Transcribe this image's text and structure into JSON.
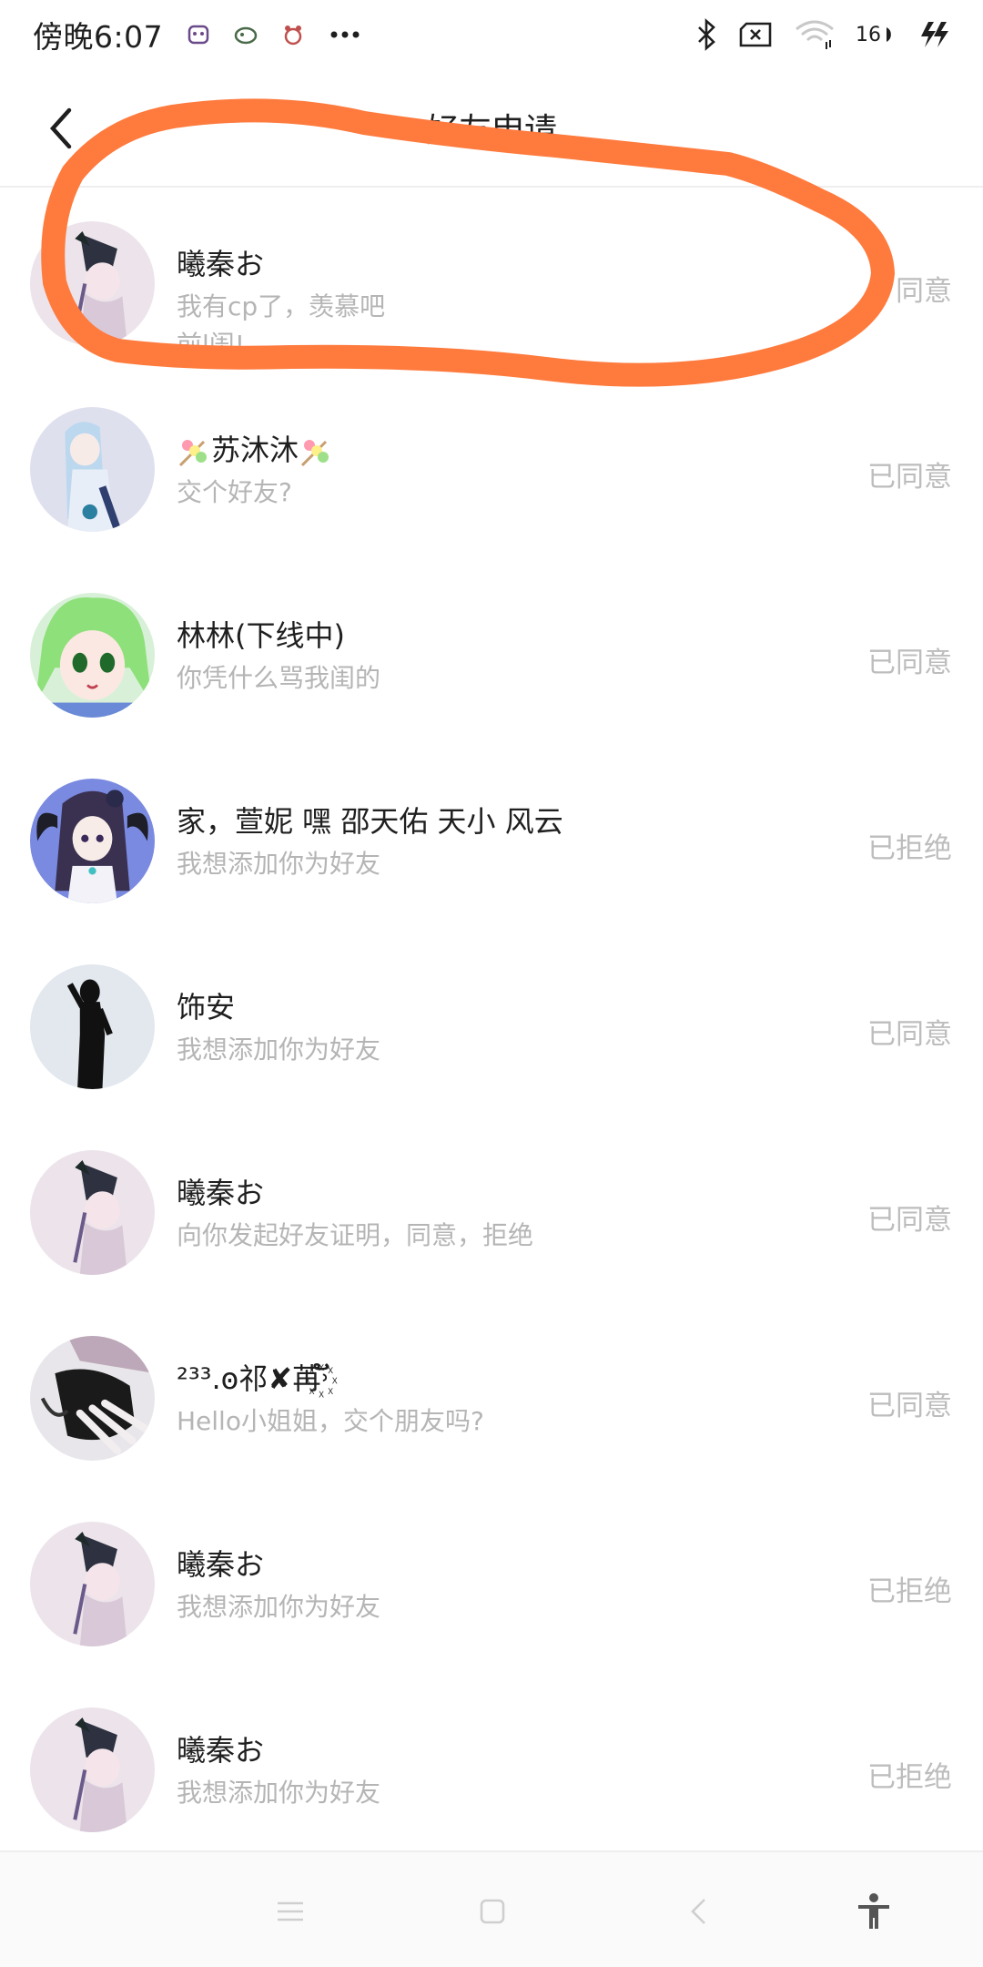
{
  "status_bar": {
    "time": "傍晚6:07",
    "battery": "16",
    "left_icons": [
      "app-badge-icon",
      "app-badge-icon",
      "app-badge-icon",
      "more-dots-icon"
    ],
    "right_icons": [
      "bluetooth-icon",
      "sim-x-icon",
      "wifi-icon",
      "battery-icon",
      "charging-icon"
    ]
  },
  "header": {
    "title": "好友申请",
    "back_icon": "back-chevron-icon"
  },
  "requests": [
    {
      "name": "曦秦お",
      "message": "我有cp了，羡慕吧",
      "message2": "前l闺!",
      "status": "同意",
      "avatar": "avatar-witch"
    },
    {
      "name": "苏沐沐",
      "message": "交个好友?",
      "status": "已同意",
      "avatar": "avatar-blue"
    },
    {
      "name": "林林(下线中)",
      "message": "你凭什么骂我闺的",
      "status": "已同意",
      "avatar": "avatar-green"
    },
    {
      "name": "家，萱妮 嘿 邵天佑 天小 风云",
      "message": "我想添加你为好友",
      "status": "已拒绝",
      "avatar": "avatar-horns"
    },
    {
      "name": "饰安",
      "message": "我想添加你为好友",
      "status": "已同意",
      "avatar": "avatar-silhouette"
    },
    {
      "name": "曦秦お",
      "message": "向你发起好友证明，同意，拒绝",
      "status": "已同意",
      "avatar": "avatar-witch"
    },
    {
      "name": "²³³.ꙩ祁✘苒꙰˒ັ",
      "message": "Hello小姐姐，交个朋友吗?",
      "status": "已同意",
      "avatar": "avatar-hand"
    },
    {
      "name": "曦秦お",
      "message": "我想添加你为好友",
      "status": "已拒绝",
      "avatar": "avatar-witch"
    },
    {
      "name": "曦秦お",
      "message": "我想添加你为好友",
      "status": "已拒绝",
      "avatar": "avatar-witch"
    }
  ],
  "annotation": {
    "color": "#ff7a3d",
    "shape": "freehand-ellipse"
  },
  "nav_bar": {
    "buttons": [
      "menu-icon",
      "home-square-icon",
      "back-triangle-icon",
      "accessibility-icon"
    ]
  }
}
